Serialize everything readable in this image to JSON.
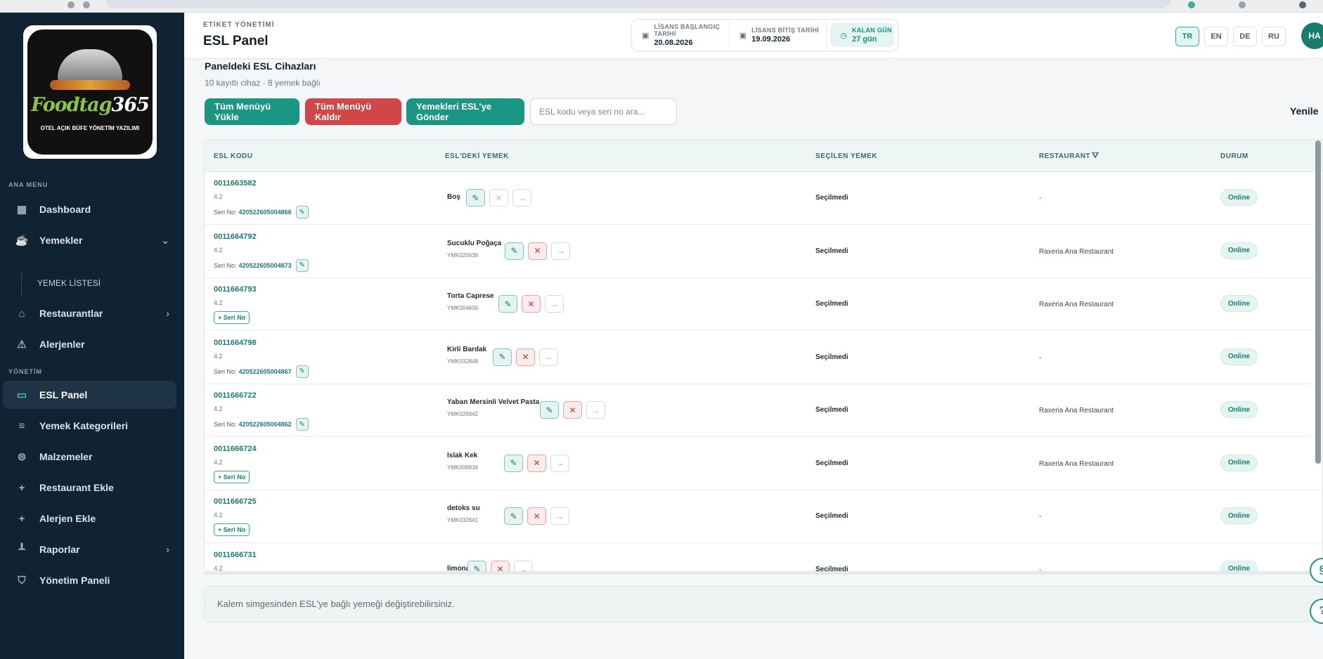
{
  "sidebar": {
    "logo_text_main_a": "Foodtag",
    "logo_text_main_b": "365",
    "logo_tagline": "OTEL AÇIK BÜFE YÖNETİM YAZILIMI",
    "section_main": "ANA MENU",
    "section_manage": "YÖNETİM",
    "items": {
      "dashboard": "Dashboard",
      "yemekler": "Yemekler",
      "yemek_listesi": "YEMEK LİSTESİ",
      "restaurantlar": "Restaurantlar",
      "alerjenler": "Alerjenler",
      "esl_panel": "ESL Panel",
      "yemek_kategorileri": "Yemek Kategorileri",
      "malzemeler": "Malzemeler",
      "restaurant_ekle": "Restaurant Ekle",
      "alerjen_ekle": "Alerjen Ekle",
      "raporlar": "Raporlar",
      "yonetim_paneli": "Yönetim Paneli"
    }
  },
  "header": {
    "kicker": "ETİKET YÖNETİMİ",
    "title": "ESL Panel",
    "license_start_label": "LİSANS BAŞLANGIÇ TARİHİ",
    "license_start": "20.08.2026",
    "license_end_label": "LİSANS BİTİŞ TARİHİ",
    "license_end": "19.09.2026",
    "days_left_label": "KALAN GÜN",
    "days_left": "27 gün",
    "languages": [
      "TR",
      "EN",
      "DE",
      "RU"
    ],
    "active_language": "TR",
    "avatar": "HA"
  },
  "panel": {
    "title": "Paneldeki ESL Cihazları",
    "subtitle": "10 kayıtlı cihaz · 8 yemek bağlı",
    "btn_load_all": "Tüm Menüyü Yükle",
    "btn_remove_all": "Tüm Menüyü Kaldır",
    "btn_send": "Yemekleri ESL'ye Gönder",
    "search_placeholder": "ESL kodu veya seri no ara...",
    "refresh": "Yenile",
    "info": "Kalem simgesinden ESL'ye bağlı yemeği değiştirebilirsiniz."
  },
  "table": {
    "columns": [
      "ESL KODU",
      "ESL'DEKİ YEMEK",
      "SEÇİLEN YEMEK",
      "RESTAURANT",
      "DURUM"
    ],
    "serial_label": "Seri No:",
    "add_serial": "+ Seri No",
    "rows": [
      {
        "code": "0011663582",
        "ver": "4.2",
        "serial": "420522605004866",
        "food": "Boş",
        "food_code": "",
        "selected": "Seçilmedi",
        "restaurant": "-",
        "status": "Online"
      },
      {
        "code": "0011664792",
        "ver": "4.2",
        "serial": "420522605004873",
        "food": "Sucuklu Poğaça",
        "food_code": "YMK025638",
        "selected": "Seçilmedi",
        "restaurant": "Raxeria Ana Restaurant",
        "status": "Online"
      },
      {
        "code": "0011664793",
        "ver": "4.2",
        "serial": "",
        "food": "Torta Caprese",
        "food_code": "YMK004606",
        "selected": "Seçilmedi",
        "restaurant": "Raxeria Ana Restaurant",
        "status": "Online"
      },
      {
        "code": "0011664798",
        "ver": "4.2",
        "serial": "420522605004867",
        "food": "Kirli Bardak",
        "food_code": "YMK032848",
        "selected": "Seçilmedi",
        "restaurant": "-",
        "status": "Online"
      },
      {
        "code": "0011666722",
        "ver": "4.2",
        "serial": "420522605004862",
        "food": "Yaban Mersinli Velvet Pasta",
        "food_code": "YMK026942",
        "selected": "Seçilmedi",
        "restaurant": "Raxeria Ana Restaurant",
        "status": "Online"
      },
      {
        "code": "0011666724",
        "ver": "4.2",
        "serial": "",
        "food": "Islak Kek",
        "food_code": "YMK008834",
        "selected": "Seçilmedi",
        "restaurant": "Raxeria Ana Restaurant",
        "status": "Online"
      },
      {
        "code": "0011666725",
        "ver": "4.2",
        "serial": "",
        "food": "detoks su",
        "food_code": "YMK032841",
        "selected": "Seçilmedi",
        "restaurant": "-",
        "status": "Online"
      },
      {
        "code": "0011666731",
        "ver": "4.2",
        "serial": "",
        "food": "limonata",
        "food_code": "",
        "selected": "Seçilmedi",
        "restaurant": "-",
        "status": "Online"
      }
    ]
  }
}
